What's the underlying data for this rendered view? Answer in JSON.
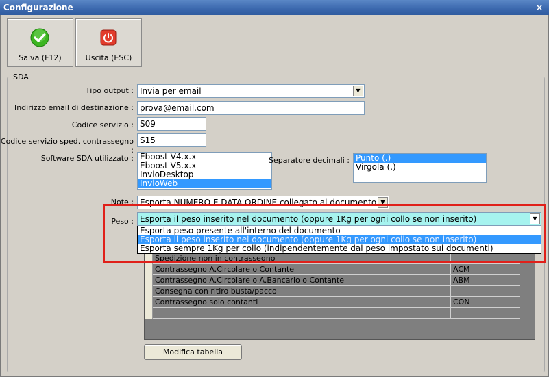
{
  "window": {
    "title": "Configurazione",
    "close_glyph": "×"
  },
  "toolbar": {
    "save_label": "Salva (F12)",
    "exit_label": "Uscita (ESC)"
  },
  "group": {
    "title": "SDA"
  },
  "form": {
    "tipo_output": {
      "label": "Tipo output :",
      "value": "Invia per email"
    },
    "email": {
      "label": "Indirizzo email di destinazione :",
      "value": "prova@email.com"
    },
    "codice_servizio": {
      "label": "Codice servizio :",
      "value": "S09"
    },
    "codice_contrassegno": {
      "label": "Codice servizio sped. contrassegno :",
      "value": "S15"
    },
    "software": {
      "label": "Software SDA utilizzato :",
      "items": [
        "Eboost V4.x.x",
        "Eboost V5.x.x",
        "InvioDesktop",
        "InvioWeb"
      ],
      "selected_index": 3
    },
    "separatore": {
      "label": "Separatore decimali :",
      "items": [
        "Punto (.)",
        "Virgola (,)"
      ],
      "selected_index": 0
    },
    "note": {
      "label": "Note :",
      "value": "Esporta NUMERO E DATA ORDINE collegato al documento"
    },
    "peso": {
      "label": "Peso :",
      "value": "Esporta il peso inserito nel documento (oppure 1Kg per ogni collo se non inserito)",
      "options": [
        "Esporta peso presente all'interno del documento",
        "Esporta il peso inserito nel documento (oppure 1Kg per ogni collo se non inserito)",
        "Esporta sempre 1Kg per collo (indipendentemente dal peso impostato sui documenti)"
      ],
      "highlighted_index": 1
    }
  },
  "table": {
    "rows": [
      {
        "desc": "Spedizione non in contrassegno",
        "code": ""
      },
      {
        "desc": "Contrassegno A.Circolare o Contante",
        "code": "ACM"
      },
      {
        "desc": "Contrassegno A.Circolare o A.Bancario o Contante",
        "code": "ABM"
      },
      {
        "desc": "Consegna con ritiro busta/pacco",
        "code": ""
      },
      {
        "desc": "Contrassegno solo contanti",
        "code": "CON"
      },
      {
        "desc": "",
        "code": ""
      }
    ]
  },
  "buttons": {
    "modifica_tabella": "Modifica tabella"
  },
  "colors": {
    "accent": "#3399ff",
    "highlight_border": "#e0201a",
    "save_icon": "#3cb521",
    "exit_icon": "#e23c2c"
  },
  "icons": {
    "save": "check-icon",
    "exit": "power-icon",
    "dropdown": "chevron-down-icon"
  }
}
